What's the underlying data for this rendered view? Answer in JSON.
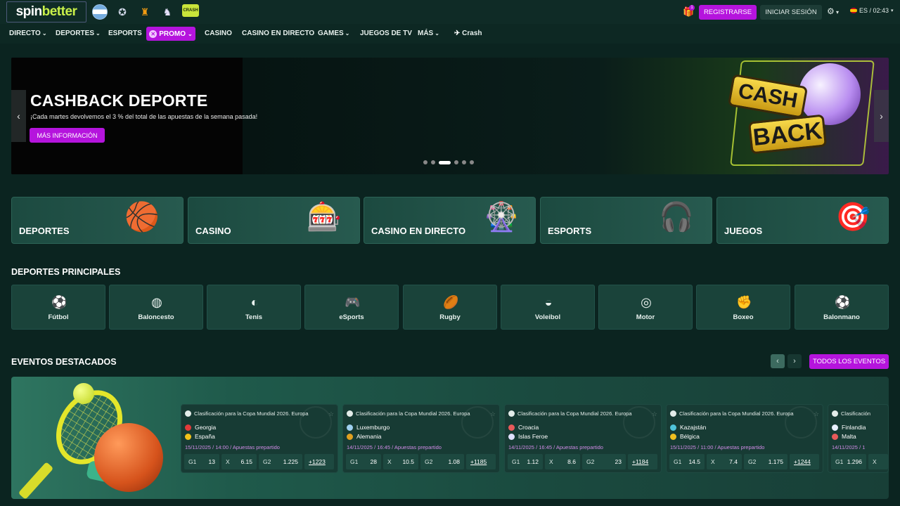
{
  "header": {
    "logo": {
      "part1": "spin",
      "part2": "better"
    },
    "badges": [
      {
        "icon": "argentina-flag-icon"
      },
      {
        "icon": "champions-league-icon",
        "glyph": "✪"
      },
      {
        "icon": "europa-league-icon",
        "glyph": "♜"
      },
      {
        "icon": "premier-league-icon",
        "glyph": "♞"
      },
      {
        "icon": "crash-game-icon",
        "text": "CRASH"
      }
    ],
    "gift_count": "1",
    "register_label": "REGISTRARSE",
    "login_label": "INICIAR SESIÓN",
    "settings_glyph": "⚙",
    "language": "ES / 02:43"
  },
  "nav": {
    "items": [
      {
        "label": "DIRECTO",
        "chevron": true
      },
      {
        "label": "DEPORTES",
        "chevron": true
      },
      {
        "label": "ESPORTS",
        "chevron": false
      },
      {
        "label": "PROMO",
        "chevron": true
      },
      {
        "label": "CASINO",
        "chevron": false
      },
      {
        "label": "CASINO EN DIRECTO",
        "chevron": false
      },
      {
        "label": "GAMES",
        "chevron": true
      },
      {
        "label": "JUEGOS DE TV",
        "chevron": false
      },
      {
        "label": "MÁS",
        "chevron": true
      },
      {
        "label": "Crash",
        "chevron": false
      }
    ]
  },
  "banner": {
    "title": "CASHBACK DEPORTE",
    "subtitle": "¡Cada martes devolvemos el 3 % del total de las apuestas de la semana pasada!",
    "button": "MÁS INFORMACIÓN",
    "art_line1": "CASH",
    "art_line2": "BACK",
    "slides": 6,
    "active_slide": 3
  },
  "categories": [
    {
      "label": "DEPORTES",
      "icon": "sports-balls-icon",
      "glyph": "🏀"
    },
    {
      "label": "CASINO",
      "icon": "slot-machine-icon",
      "glyph": "🎰"
    },
    {
      "label": "CASINO EN DIRECTO",
      "icon": "roulette-icon",
      "glyph": "🎡"
    },
    {
      "label": "ESPORTS",
      "icon": "gamepad-headset-icon",
      "glyph": "🎧"
    },
    {
      "label": "JUEGOS",
      "icon": "wheel-game-icon",
      "glyph": "🎯"
    }
  ],
  "main_sports": {
    "title": "DEPORTES PRINCIPALES",
    "items": [
      {
        "label": "Fútbol",
        "icon": "football-icon",
        "glyph": "⚽"
      },
      {
        "label": "Baloncesto",
        "icon": "basketball-icon",
        "glyph": "◍"
      },
      {
        "label": "Tenis",
        "icon": "tennis-icon",
        "glyph": "◐"
      },
      {
        "label": "eSports",
        "icon": "gamepad-icon",
        "glyph": "🎮"
      },
      {
        "label": "Rugby",
        "icon": "rugby-icon",
        "glyph": "🏉"
      },
      {
        "label": "Voleibol",
        "icon": "volleyball-icon",
        "glyph": "◒"
      },
      {
        "label": "Motor",
        "icon": "steering-wheel-icon",
        "glyph": "◎"
      },
      {
        "label": "Boxeo",
        "icon": "boxing-glove-icon",
        "glyph": "✊"
      },
      {
        "label": "Balonmano",
        "icon": "handball-icon",
        "glyph": "⚽"
      }
    ]
  },
  "featured": {
    "title": "EVENTOS DESTACADOS",
    "all_button": "TODOS LOS EVENTOS",
    "events": [
      {
        "league": "Clasificación para la Copa Mundial 2026. Europa",
        "team1": "Georgia",
        "team1_color": "#e23a3a",
        "team2": "España",
        "team2_color": "#f2c21a",
        "date": "15/11/2025 / 14:00 / Apuestas prepartido",
        "odds": [
          {
            "k": "G1",
            "v": "13"
          },
          {
            "k": "X",
            "v": "6.15"
          },
          {
            "k": "G2",
            "v": "1.225"
          }
        ],
        "more": "+1223"
      },
      {
        "league": "Clasificación para la Copa Mundial 2026. Europa",
        "team1": "Luxemburgo",
        "team1_color": "#9fd0f0",
        "team2": "Alemania",
        "team2_color": "#e0a020",
        "date": "14/11/2025 / 16:45 / Apuestas prepartido",
        "odds": [
          {
            "k": "G1",
            "v": "28"
          },
          {
            "k": "X",
            "v": "10.5"
          },
          {
            "k": "G2",
            "v": "1.08"
          }
        ],
        "more": "+1185"
      },
      {
        "league": "Clasificación para la Copa Mundial 2026. Europa",
        "team1": "Croacia",
        "team1_color": "#e85a5a",
        "team2": "Islas Feroe",
        "team2_color": "#e0e0ff",
        "date": "14/11/2025 / 16:45 / Apuestas prepartido",
        "odds": [
          {
            "k": "G1",
            "v": "1.12"
          },
          {
            "k": "X",
            "v": "8.6"
          },
          {
            "k": "G2",
            "v": "23"
          }
        ],
        "more": "+1184"
      },
      {
        "league": "Clasificación para la Copa Mundial 2026. Europa",
        "team1": "Kazajstán",
        "team1_color": "#4fc3d9",
        "team2": "Bélgica",
        "team2_color": "#f0c020",
        "date": "15/11/2025 / 11:00 / Apuestas prepartido",
        "odds": [
          {
            "k": "G1",
            "v": "14.5"
          },
          {
            "k": "X",
            "v": "7.4"
          },
          {
            "k": "G2",
            "v": "1.175"
          }
        ],
        "more": "+1244"
      },
      {
        "league": "Clasificación",
        "team1": "Finlandia",
        "team1_color": "#e8f0ff",
        "team2": "Malta",
        "team2_color": "#e85a5a",
        "date": "14/11/2025 / 1",
        "odds": [
          {
            "k": "G1",
            "v": "1.296"
          },
          {
            "k": "X",
            "v": ""
          },
          {
            "k": "G2",
            "v": ""
          }
        ],
        "more": ""
      }
    ]
  }
}
